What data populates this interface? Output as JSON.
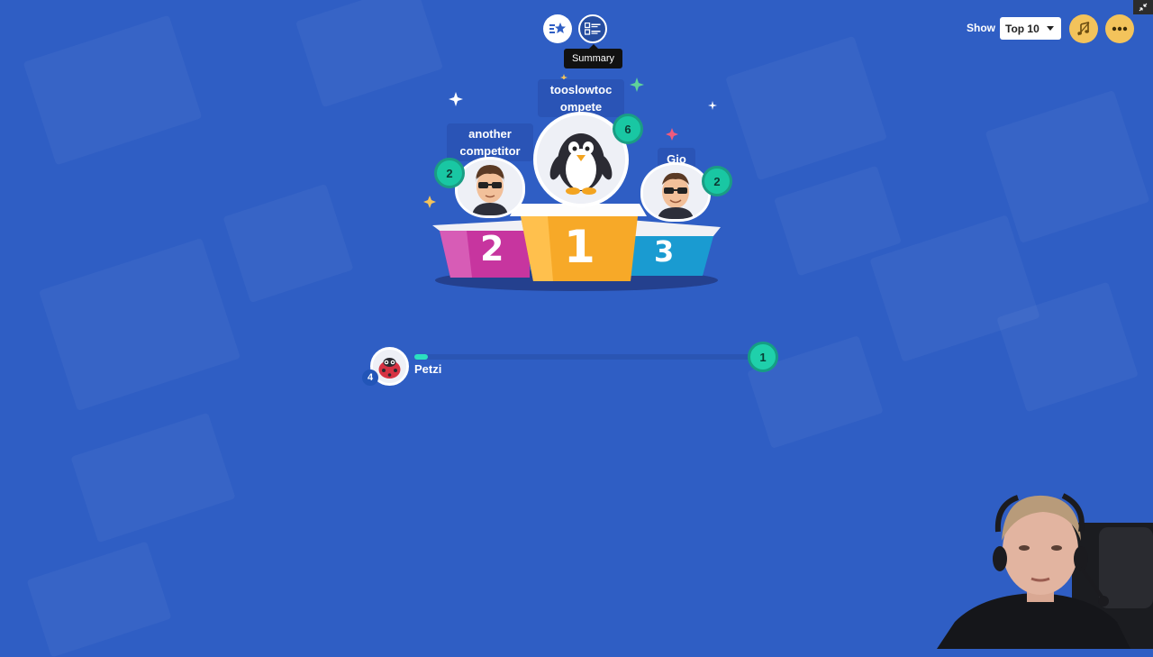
{
  "view_toggle": {
    "podium_icon": "star-list-icon",
    "summary_icon": "summary-table-icon",
    "tooltip": "Summary"
  },
  "controls": {
    "show_label": "Show",
    "show_value": "Top 10",
    "music_icon": "music-note-icon",
    "more_icon": "more-dots-icon",
    "corner_icon": "collapse-icon"
  },
  "podium": {
    "first": {
      "rank": "1",
      "name": "tooslowtoc ompete",
      "score": "6",
      "avatar": "penguin"
    },
    "second": {
      "rank": "2",
      "name": "another competitor",
      "score": "2",
      "avatar": "sunglasses-guy"
    },
    "third": {
      "rank": "3",
      "name": "Gio",
      "score": "2",
      "avatar": "sunglasses-guy"
    }
  },
  "leaderboard": [
    {
      "rank": "4",
      "name": "Petzi",
      "score": "1",
      "progress": 0.04,
      "avatar": "ladybug"
    }
  ],
  "colors": {
    "background": "#2f5ec4",
    "podium_first": "#f7a928",
    "podium_second": "#cc3aa8",
    "podium_third": "#1a9bd1",
    "score_badge": "#19c7a3"
  }
}
